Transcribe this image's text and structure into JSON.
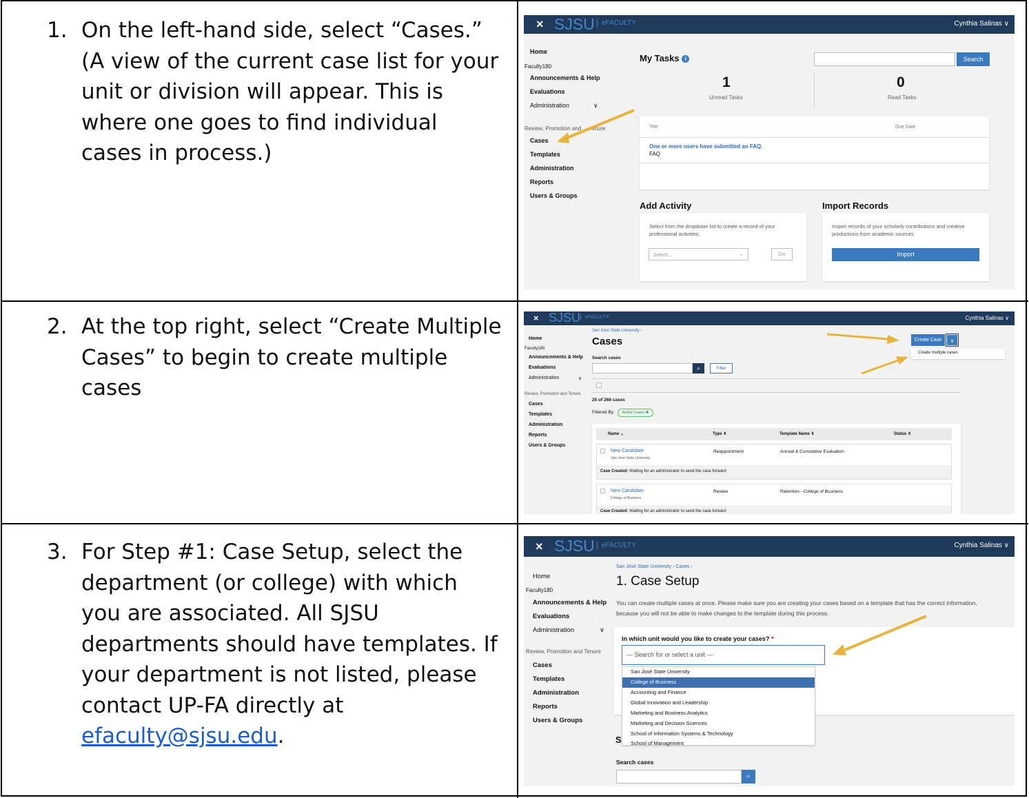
{
  "steps": [
    {
      "number": "1.",
      "text": "On the left-hand side, select “Cases.” (A view of the current case list for your unit or division will appear. This is where one goes to find individual cases in process.)"
    },
    {
      "number": "2.",
      "text": "At the top right, select “Create Multiple Cases” to begin to create multiple cases"
    },
    {
      "number": "3.",
      "text": "For Step #1: Case Setup, select the department (or college) with which you are associated. All SJSU departments should have templates. If your department is not listed, please contact UP-FA directly at ",
      "link": "efaculty@sjsu.edu",
      "end": "."
    }
  ],
  "app": {
    "close": "×",
    "logo": "SJSU",
    "product": "eFACULTY",
    "user": "Cynthia Salinas ∨"
  },
  "nav": {
    "home": "Home",
    "faculty180": "Faculty180",
    "announcements": "Announcements & Help",
    "evaluations": "Evaluations",
    "administration": "Administration",
    "chevron": "∨",
    "rpt": "Review, Promotion and Tenure",
    "rpt_clipped": "Review, Promotion and",
    "rpt_tail": "enure",
    "cases": "Cases",
    "templates": "Templates",
    "administration2": "Administration",
    "reports": "Reports",
    "users_groups": "Users & Groups"
  },
  "shot1": {
    "my_tasks": "My Tasks",
    "info": "i",
    "search_btn": "Search",
    "unread_count": "1",
    "unread_label": "Unread Tasks",
    "read_count": "0",
    "read_label": "Read Tasks",
    "col_title": "Title",
    "col_due": "Due Date",
    "task_link": "One or more users have submitted an FAQ.",
    "task_sub": "FAQ",
    "add_activity": "Add Activity",
    "add_desc": "Select from the dropdown list to create a record of your professional activities.",
    "select_placeholder": "Select...",
    "go": "Go",
    "import_records": "Import Records",
    "import_desc": "Import records of your scholarly contributions and creative productions from academic sources.",
    "import_btn": "Import"
  },
  "shot2": {
    "breadcrumb": "San José State University  ›",
    "title": "Cases",
    "create_case": "Create Case",
    "create_multiple": "Create multiple cases",
    "search_label": "Search cases",
    "filter": "Filter",
    "count": "25 of 268 cases",
    "filtered_by": "Filtered By:",
    "chip": "Active Cases  ✖",
    "columns": [
      "Name ⌄",
      "Type ⇕",
      "Template Name ⇕",
      "Status ⇕"
    ],
    "rows": [
      {
        "name": "New Candidate",
        "unit": "San José State University",
        "type": "Reappointment",
        "template": "Annual & Cumulative Evaluation",
        "status": "Case Created:",
        "status_text": " Waiting for an administrator to send the case forward"
      },
      {
        "name": "New Candidate",
        "unit": "College of Business",
        "type": "Review",
        "template": "Retention - College of Business",
        "status": "Case Created:",
        "status_text": " Waiting for an administrator to send the case forward"
      }
    ]
  },
  "shot3": {
    "breadcrumb": "San José State University  ›  Cases  ›",
    "title": "1. Case Setup",
    "desc1": "You can create multiple cases at once. Please make sure you are creating your cases based on a template that has the correct information,",
    "desc2": "because you will not be able to make changes to the template during this process.",
    "question": "In which unit would you like to create your cases?",
    "required": "*",
    "unit_placeholder": "— Search for or select a unit —",
    "options": [
      "San José State University",
      "College of Business",
      "Accounting and Finance",
      "Global Innovation and Leadership",
      "Marketing and Business Analytics",
      "Marketing and Decision Sciences",
      "School of Information Systems & Technology",
      "School of Management"
    ],
    "selected_index": 1,
    "section_clipped": "S",
    "search_label": "Search cases"
  },
  "colors": {
    "navbar": "#1f3a5a",
    "accent": "#3a7abf",
    "link": "#2a6cb8",
    "arrow": "#e8b33a",
    "highlight": "#3e6fb0"
  }
}
